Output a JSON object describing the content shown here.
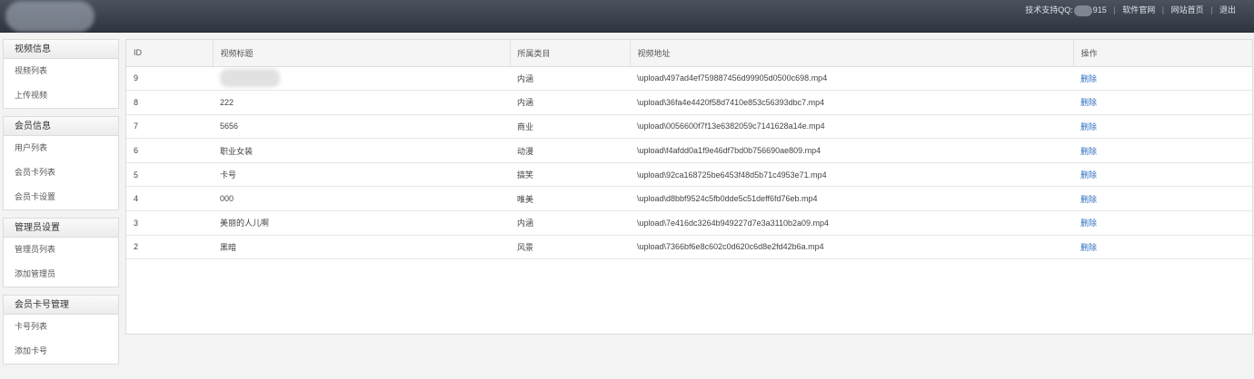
{
  "header": {
    "support_label": "技术支持QQ:",
    "support_suffix": "915",
    "links": [
      "软件官网",
      "网站首页",
      "退出"
    ]
  },
  "sidebar": {
    "groups": [
      {
        "title": "视频信息",
        "items": [
          "视频列表",
          "上传视频"
        ]
      },
      {
        "title": "会员信息",
        "items": [
          "用户列表",
          "会员卡列表",
          "会员卡设置"
        ]
      },
      {
        "title": "管理员设置",
        "items": [
          "管理员列表",
          "添加管理员"
        ]
      },
      {
        "title": "会员卡号管理",
        "items": [
          "卡号列表",
          "添加卡号"
        ]
      }
    ]
  },
  "table": {
    "headers": [
      "ID",
      "视频标题",
      "所属类目",
      "视频地址",
      "操作"
    ],
    "rows": [
      {
        "id": "9",
        "title": "",
        "category": "内涵",
        "url": "\\upload\\497ad4ef759887456d99905d0500c698.mp4",
        "action": "删除"
      },
      {
        "id": "8",
        "title": "222",
        "category": "内涵",
        "url": "\\upload\\36fa4e4420f58d7410e853c56393dbc7.mp4",
        "action": "删除"
      },
      {
        "id": "7",
        "title": "5656",
        "category": "商业",
        "url": "\\upload\\0056600f7f13e6382059c7141628a14e.mp4",
        "action": "删除"
      },
      {
        "id": "6",
        "title": "职业女装",
        "category": "动漫",
        "url": "\\upload\\f4afdd0a1f9e46df7bd0b756690ae809.mp4",
        "action": "删除"
      },
      {
        "id": "5",
        "title": "卡号",
        "category": "搞笑",
        "url": "\\upload\\92ca168725be6453f48d5b71c4953e71.mp4",
        "action": "删除"
      },
      {
        "id": "4",
        "title": "000",
        "category": "唯美",
        "url": "\\upload\\d8bbf9524c5fb0dde5c51deff6fd76eb.mp4",
        "action": "删除"
      },
      {
        "id": "3",
        "title": "美丽的人儿啊",
        "category": "内涵",
        "url": "\\upload\\7e416dc3264b949227d7e3a3110b2a09.mp4",
        "action": "删除"
      },
      {
        "id": "2",
        "title": "黑暗",
        "category": "风景",
        "url": "\\upload\\7366bf6e8c602c0d620c6d8e2fd42b6a.mp4",
        "action": "删除"
      }
    ]
  }
}
